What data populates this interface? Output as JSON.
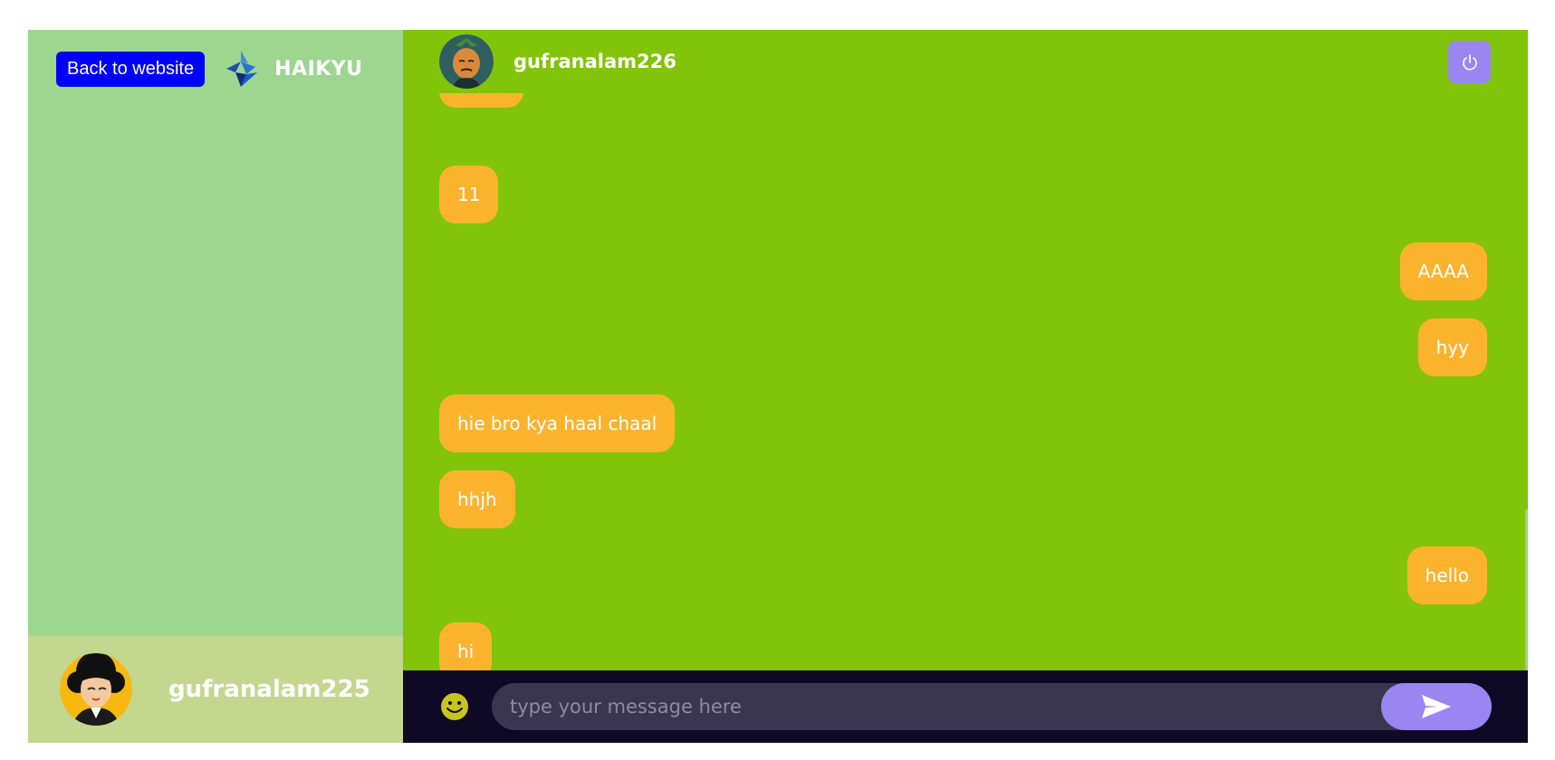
{
  "sidebar": {
    "back_label": "Back to website",
    "brand_name": "HAIKYU",
    "logo_icon": "diamond-logo-icon",
    "current_user": {
      "name": "gufranalam225",
      "avatar": "user-avatar-icon"
    }
  },
  "chat": {
    "peer": {
      "name": "gufranalam226",
      "avatar": "peer-avatar-icon"
    },
    "power_icon": "power-icon",
    "messages": [
      {
        "text": "11",
        "side": "left"
      },
      {
        "text": "AAAA",
        "side": "right"
      },
      {
        "text": "hyy",
        "side": "right"
      },
      {
        "text": "hie bro kya haal chaal",
        "side": "left"
      },
      {
        "text": "hhjh",
        "side": "left"
      },
      {
        "text": "hello",
        "side": "right"
      },
      {
        "text": "hi",
        "side": "left"
      }
    ],
    "composer": {
      "placeholder": "type your message here",
      "emoji_icon": "smiley-icon",
      "send_icon": "send-icon"
    }
  },
  "colors": {
    "sidebar_bg": "#9cd68f",
    "current_user_bar": "#c3d78f",
    "chat_bg": "#82c409",
    "bubble": "#fbb32e",
    "back_button": "#0000ff",
    "accent": "#9a86f0",
    "composer_bg": "#0e0a26"
  }
}
